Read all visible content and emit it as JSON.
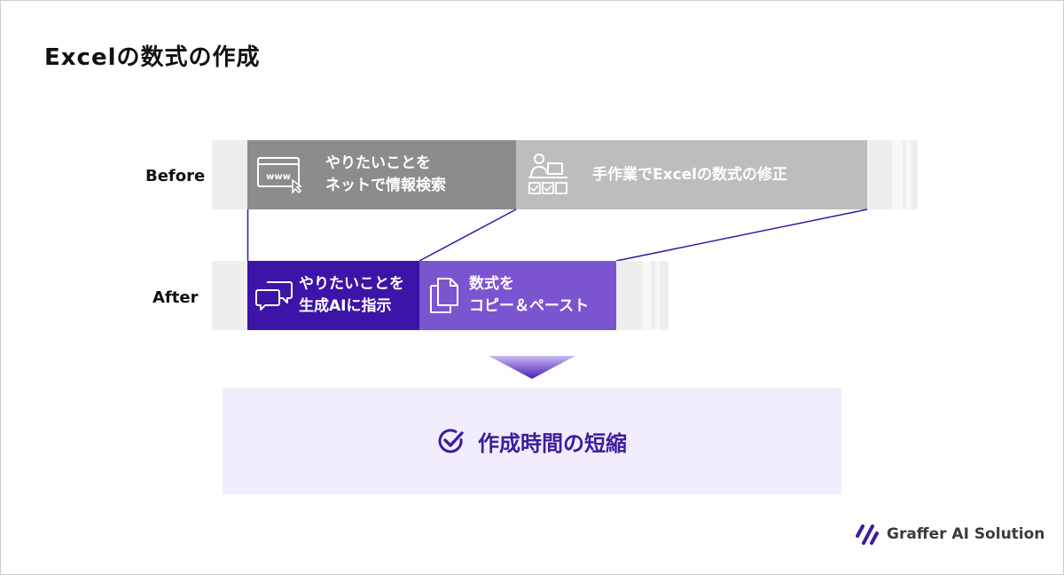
{
  "title": "Excelの数式の作成",
  "before": {
    "label": "Before",
    "steps": [
      {
        "icon": "browser-www-icon",
        "line1": "やりたいことを",
        "line2": "ネットで情報検索"
      },
      {
        "icon": "person-at-desk-icon",
        "line1": "手作業でExcelの数式の修正"
      }
    ]
  },
  "after": {
    "label": "After",
    "steps": [
      {
        "icon": "chat-bubbles-icon",
        "line1": "やりたいことを",
        "line2": "生成AIに指示"
      },
      {
        "icon": "copy-documents-icon",
        "line1": "数式を",
        "line2": "コピー＆ペースト"
      }
    ]
  },
  "result": {
    "icon": "check-circle-icon",
    "text": "作成時間の短縮"
  },
  "brand": {
    "name": "Graffer AI Solution"
  },
  "colors": {
    "before_step1": "#8c8c8c",
    "before_step2": "#bdbdbd",
    "after_step1": "#3c14a8",
    "after_step2": "#7b54d0",
    "connector": "#3c14a8",
    "result_bg": "#f2edfd",
    "accent": "#3c1c9e"
  }
}
